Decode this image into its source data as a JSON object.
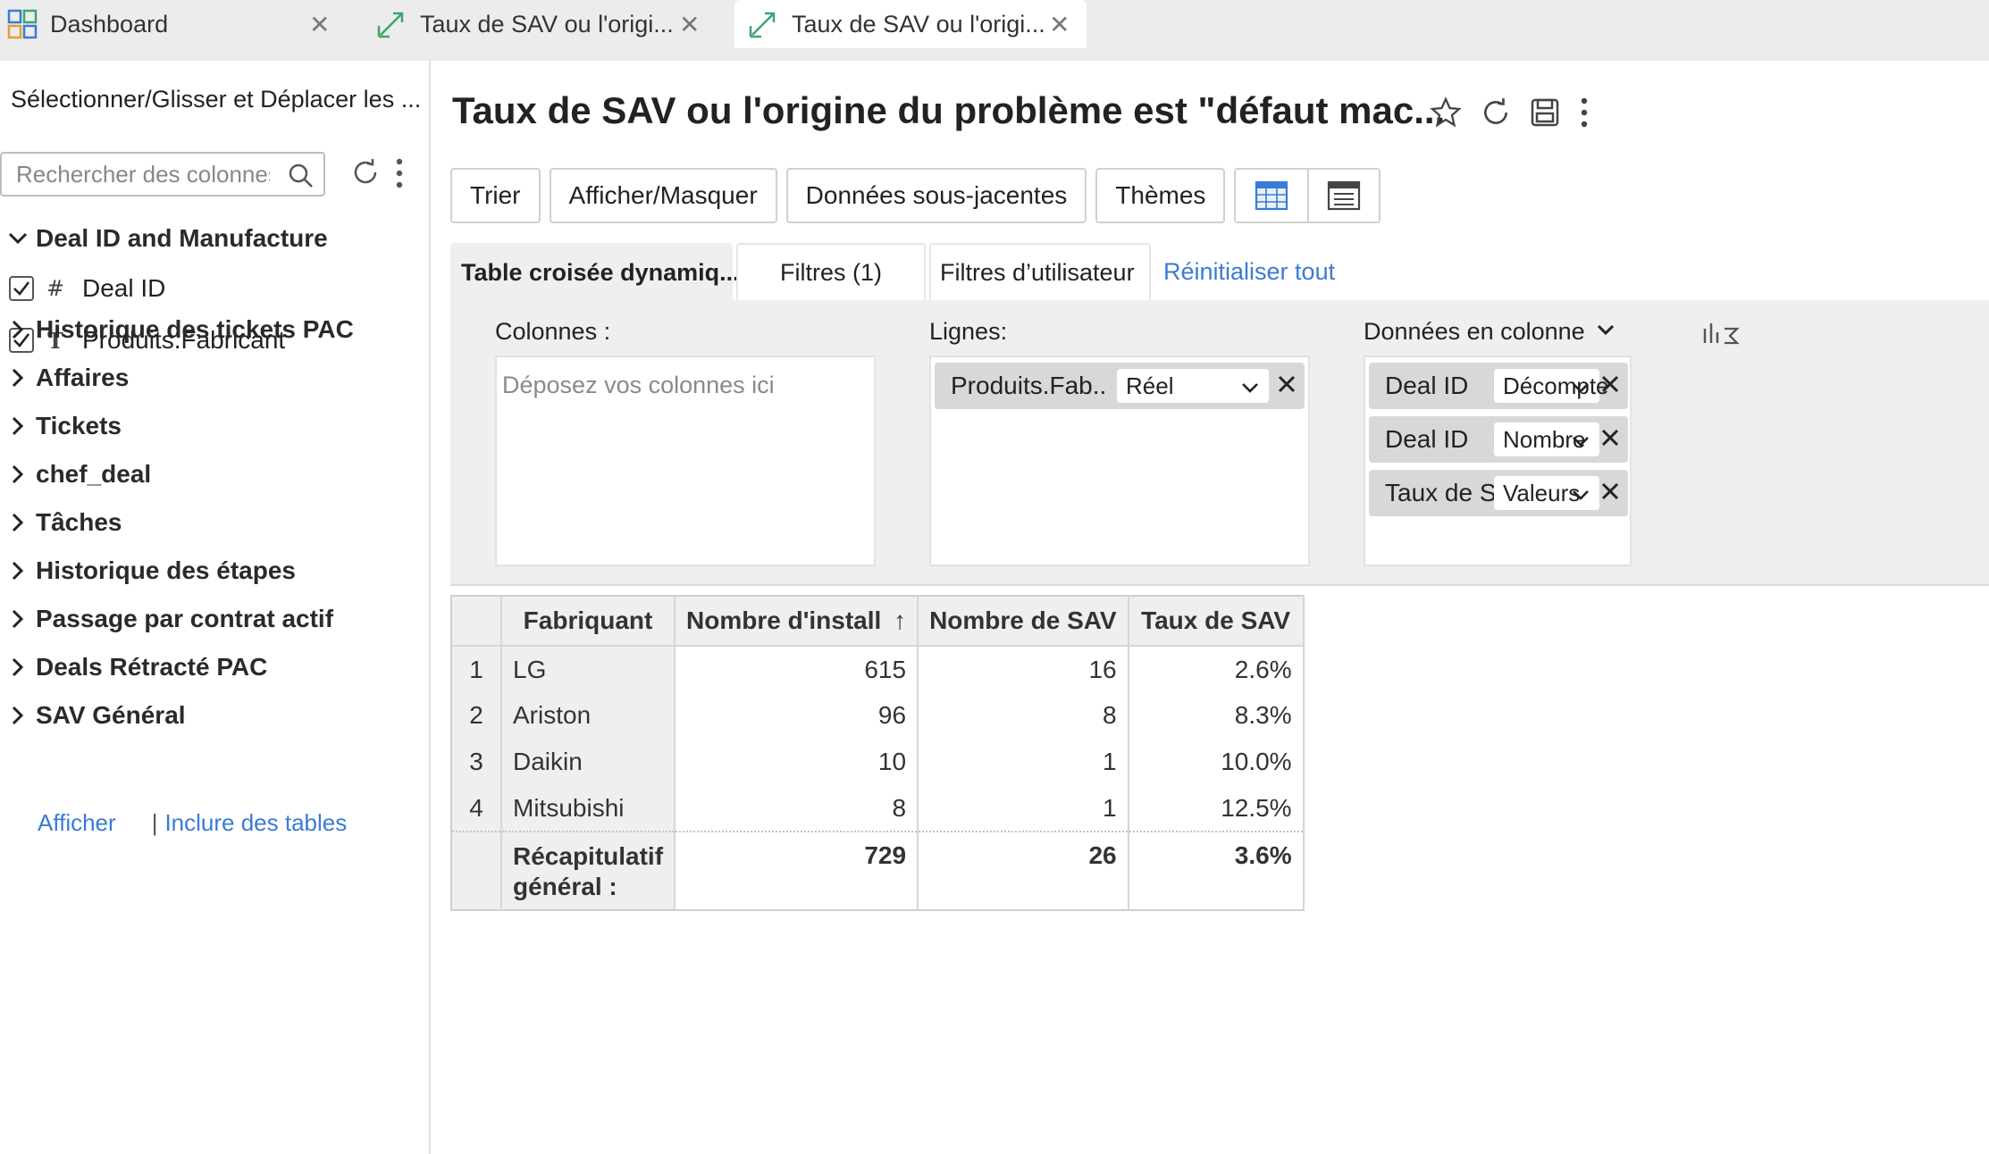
{
  "tabs": [
    {
      "label": "Dashboard",
      "icon": "dashboard-icon"
    },
    {
      "label": "Taux de SAV ou l'origi...",
      "icon": "chart-link-icon"
    },
    {
      "label": "Taux de SAV ou l'origi...",
      "icon": "chart-link-icon"
    }
  ],
  "sidebar": {
    "header": "Sélectionner/Glisser et Déplacer les ...",
    "search_placeholder": "Rechercher des colonnes",
    "group_open": "Deal ID and Manufacture",
    "columns": [
      {
        "type_glyph": "#",
        "label": "Deal ID",
        "checked": true
      },
      {
        "type_glyph": "T",
        "label": "Produits.Fabricant",
        "checked": true
      }
    ],
    "groups": [
      "Historique des tickets PAC",
      "Affaires",
      "Tickets",
      "chef_deal",
      "Tâches",
      "Historique des étapes",
      "Passage par contrat actif",
      "Deals Rétracté PAC",
      "SAV Général"
    ],
    "link_show": "Afficher",
    "link_sep": "|",
    "link_include": "Inclure des tables"
  },
  "main": {
    "title": "Taux de SAV ou l'origine du problème est \"défaut mac..."
  },
  "toolbar": {
    "sort": "Trier",
    "show_hide": "Afficher/Masquer",
    "underlying": "Données sous-jacentes",
    "themes": "Thèmes"
  },
  "subtabs": {
    "pivot": "Table croisée dynamiq...",
    "filters": "Filtres  (1)",
    "user_filters": "Filtres d’utilisateur",
    "reset": "Réinitialiser tout"
  },
  "pivot": {
    "columns_label": "Colonnes :",
    "columns_placeholder": "Déposez vos colonnes ici",
    "rows_label": "Lignes:",
    "rows_chip": {
      "name": "Produits.Fab...",
      "agg": "Réel"
    },
    "data_label": "Données en colonne",
    "data_chips": [
      {
        "name": "Deal ID",
        "agg": "Décompte"
      },
      {
        "name": "Deal ID",
        "agg": "Nombre"
      },
      {
        "name": "Taux de SAV ...",
        "agg": "Valeurs"
      }
    ]
  },
  "table": {
    "headers": [
      "Fabriquant",
      "Nombre d'install",
      "Nombre de SAV",
      "Taux de SAV"
    ],
    "sort_arrow": "↑",
    "rows": [
      {
        "idx": "1",
        "name": "LG",
        "installs": "615",
        "sav": "16",
        "rate": "2.6%"
      },
      {
        "idx": "2",
        "name": "Ariston",
        "installs": "96",
        "sav": "8",
        "rate": "8.3%"
      },
      {
        "idx": "3",
        "name": "Daikin",
        "installs": "10",
        "sav": "1",
        "rate": "10.0%"
      },
      {
        "idx": "4",
        "name": "Mitsubishi",
        "installs": "8",
        "sav": "1",
        "rate": "12.5%"
      }
    ],
    "total": {
      "label": "Récapitulatif général :",
      "installs": "729",
      "sav": "26",
      "rate": "3.6%"
    }
  },
  "colors": {
    "accent": "#3a7bd5",
    "tab_icon": "#3aa76d"
  }
}
